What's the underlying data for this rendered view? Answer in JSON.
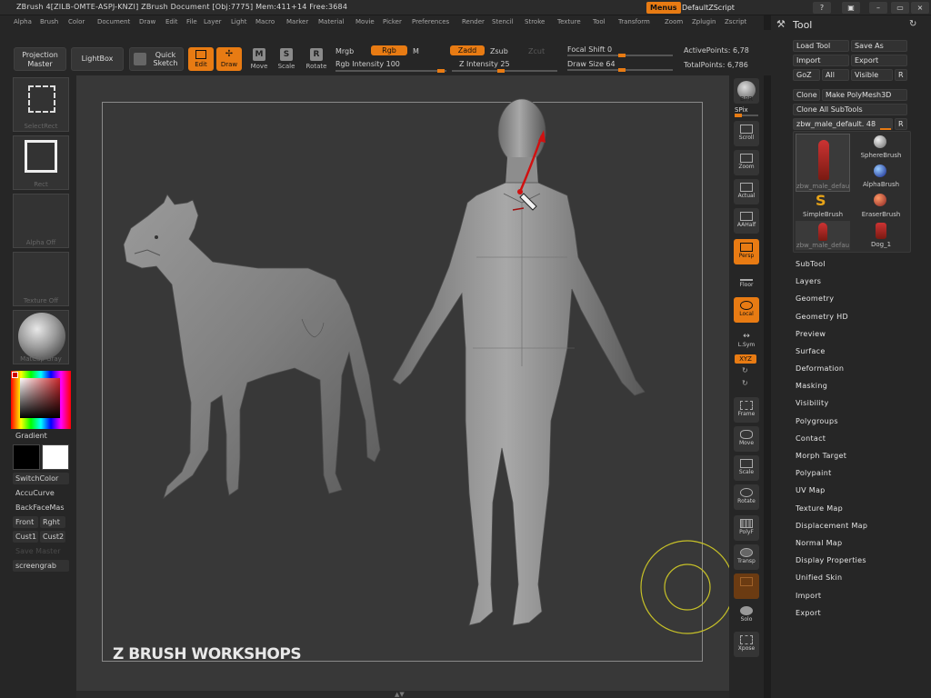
{
  "titlebar": {
    "title": "ZBrush 4[ZILB-OMTE-ASPJ-KNZI]    ZBrush Document    [Obj:7775] Mem:411+14 Free:3684",
    "menus_label": "Menus",
    "script_label": "DefaultZScript",
    "icons": [
      "help-icon",
      "lock-icon",
      "minimize-icon",
      "restore-icon",
      "close-icon"
    ]
  },
  "menubar": [
    "Alpha",
    "Brush",
    "Color",
    "Document",
    "Draw",
    "Edit",
    "File",
    "Layer",
    "Light",
    "Macro",
    "Marker",
    "Material",
    "Movie",
    "Picker",
    "Preferences",
    "Render",
    "Stencil",
    "Stroke",
    "Texture",
    "Tool",
    "Transform",
    "Zoom",
    "Zplugin",
    "Zscript"
  ],
  "shelf": {
    "projection_master": "Projection Master",
    "lightbox": "LightBox",
    "quick_sketch": "Quick Sketch",
    "edit": "Edit",
    "draw": "Draw",
    "move": "Move",
    "scale": "Scale",
    "rotate": "Rotate",
    "mrgb": "Mrgb",
    "rgb": "Rgb",
    "m": "M",
    "rgb_intensity": "Rgb Intensity 100",
    "zadd": "Zadd",
    "zsub": "Zsub",
    "zcut": "Zcut",
    "z_intensity": "Z Intensity 25",
    "focal_shift": "Focal Shift 0",
    "draw_size": "Draw Size 64",
    "active_points": "ActivePoints: 6,78",
    "total_points": "TotalPoints: 6,786"
  },
  "left": {
    "select_rect": "SelectRect",
    "rect": "Rect",
    "alpha_off": "Alpha Off",
    "texture_off": "Texture Off",
    "matcap_gray": "MatCap Gray",
    "gradient": "Gradient",
    "switch_color": "SwitchColor",
    "accucurve": "AccuCurve",
    "backfacemask": "BackFaceMas",
    "front": "Front",
    "rght": "Rght",
    "cust1": "Cust1",
    "cust2": "Cust2",
    "save_master": "Save Master",
    "screengrab": "screengrab"
  },
  "canvas": {
    "watermark": "Z BRUSH WORKSHOPS"
  },
  "right": [
    {
      "name": "bpr",
      "label": "BPR"
    },
    {
      "name": "spix",
      "label": "SPix"
    },
    {
      "name": "scroll",
      "label": "Scroll"
    },
    {
      "name": "zoom",
      "label": "Zoom"
    },
    {
      "name": "actual",
      "label": "Actual"
    },
    {
      "name": "aahalf",
      "label": "AAHalf"
    },
    {
      "name": "persp",
      "label": "Persp"
    },
    {
      "name": "floor",
      "label": "Floor"
    },
    {
      "name": "local",
      "label": "Local"
    },
    {
      "name": "lsym",
      "label": "L.Sym"
    },
    {
      "name": "xyz",
      "label": "XYZ"
    },
    {
      "name": "frame",
      "label": "Frame"
    },
    {
      "name": "move",
      "label": "Move"
    },
    {
      "name": "scale",
      "label": "Scale"
    },
    {
      "name": "rotate",
      "label": "Rotate"
    },
    {
      "name": "polyf",
      "label": "PolyF"
    },
    {
      "name": "transp",
      "label": "Transp"
    },
    {
      "name": "solo",
      "label": "Solo"
    },
    {
      "name": "xpose",
      "label": "Xpose"
    }
  ],
  "palette": {
    "title": "Tool",
    "load_tool": "Load Tool",
    "save_as": "Save As",
    "import": "Import",
    "export": "Export",
    "goz": "GoZ",
    "all": "All",
    "visible": "Visible",
    "r": "R",
    "clone": "Clone",
    "make_polymesh": "Make PolyMesh3D",
    "clone_all": "Clone  All  SubTools",
    "current_tool": "zbw_male_default. 48",
    "thumbs": [
      {
        "label": "zbw_male_defau"
      },
      {
        "label": "SphereBrush"
      },
      {
        "label": "AlphaBrush"
      },
      {
        "label": "SimpleBrush"
      },
      {
        "label": "EraserBrush"
      },
      {
        "label": "zbw_male_defau"
      },
      {
        "label": "Dog_1"
      }
    ],
    "subpalettes": [
      "SubTool",
      "Layers",
      "Geometry",
      "Geometry HD",
      "Preview",
      "Surface",
      "Deformation",
      "Masking",
      "Visibility",
      "Polygroups",
      "Contact",
      "Morph Target",
      "Polypaint",
      "UV Map",
      "Texture Map",
      "Displacement Map",
      "Normal Map",
      "Display Properties",
      "Unified Skin",
      "Import",
      "Export"
    ]
  },
  "colors": {
    "accent": "#e87b13",
    "canvas": "#383838",
    "ui_bg": "#262626"
  }
}
